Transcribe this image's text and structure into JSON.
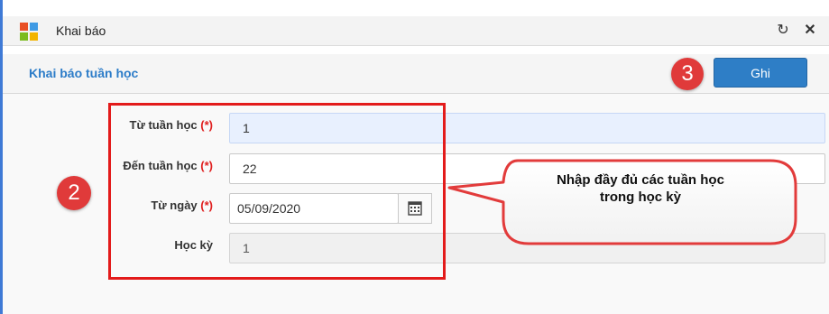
{
  "window": {
    "title": "Khai báo",
    "refresh_symbol": "↻",
    "close_symbol": "✕"
  },
  "section": {
    "title": "Khai báo tuần học",
    "save_label": "Ghi"
  },
  "steps": {
    "save_step": "3",
    "form_step": "2"
  },
  "form": {
    "required_marker": "(*)",
    "from_week": {
      "label": "Từ tuần học",
      "value": "1"
    },
    "to_week": {
      "label": "Đến tuần học",
      "value": "22"
    },
    "from_date": {
      "label": "Từ ngày",
      "value": "05/09/2020"
    },
    "semester": {
      "label": "Học kỳ",
      "value": "1"
    }
  },
  "callout": {
    "text": "Nhập đầy đủ các tuần học\ntrong học kỳ"
  },
  "colors": {
    "accent": "#2e7ec6",
    "highlight_red": "#e31b1b",
    "focused_input_bg": "#e8f0fe"
  },
  "icons": [
    "app-logo-icon",
    "refresh-icon",
    "close-icon",
    "calendar-icon"
  ]
}
